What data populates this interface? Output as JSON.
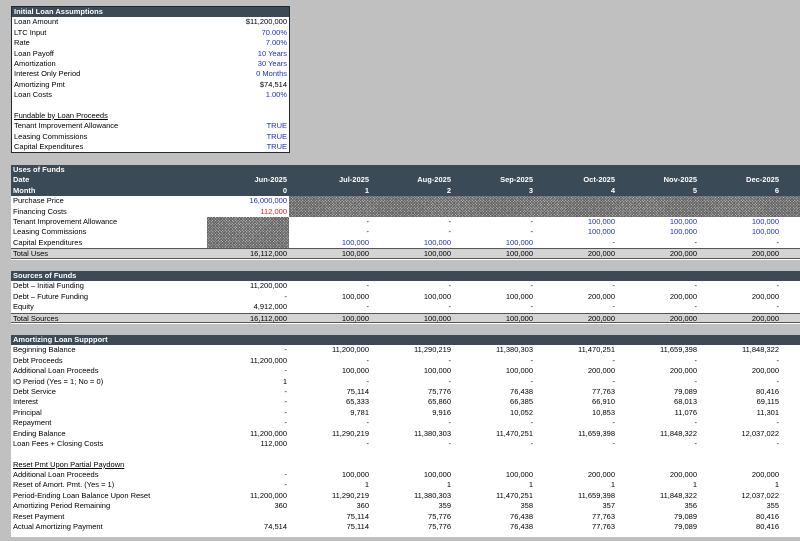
{
  "assumptions": {
    "title": "Initial Loan Assumptions",
    "rows": [
      {
        "label": "Loan Amount",
        "value": "$11,200,000",
        "color": "black"
      },
      {
        "label": "LTC Input",
        "value": "70.00%",
        "color": "blue"
      },
      {
        "label": "Rate",
        "value": "7.00%",
        "color": "blue"
      },
      {
        "label": "Loan Payoff",
        "value": "10 Years",
        "color": "blue"
      },
      {
        "label": "Amortization",
        "value": "30 Years",
        "color": "blue"
      },
      {
        "label": "Interest Only Period",
        "value": "0 Months",
        "color": "blue"
      },
      {
        "label": "Amortizing Pmt",
        "value": "$74,514",
        "color": "black"
      },
      {
        "label": "Loan Costs",
        "value": "1.00%",
        "color": "blue"
      }
    ],
    "fundable_title": "Fundable by Loan Proceeds",
    "fundable_rows": [
      {
        "label": "Tenant Improvement Allowance",
        "value": "TRUE"
      },
      {
        "label": "Leasing Commissions",
        "value": "TRUE"
      },
      {
        "label": "Capital Expenditures",
        "value": "TRUE"
      }
    ]
  },
  "uses": {
    "title": "Uses of Funds",
    "date_label": "Date",
    "month_label": "Month",
    "dates": [
      "Jun-2025",
      "Jul-2025",
      "Aug-2025",
      "Sep-2025",
      "Oct-2025",
      "Nov-2025",
      "Dec-2025"
    ],
    "months": [
      "0",
      "1",
      "2",
      "3",
      "4",
      "5",
      "6"
    ],
    "rows": [
      {
        "label": "Purchase Price",
        "values": [
          "16,000,000",
          "",
          "",
          "",
          "",
          "",
          ""
        ],
        "colors": [
          "blue",
          "",
          "",
          "",
          "",
          "",
          ""
        ]
      },
      {
        "label": "Financing Costs",
        "values": [
          "112,000",
          "",
          "",
          "",
          "",
          "",
          ""
        ],
        "colors": [
          "red",
          "",
          "",
          "",
          "",
          "",
          ""
        ]
      },
      {
        "label": "Tenant Improvement Allowance",
        "values": [
          "",
          "-",
          "-",
          "-",
          "100,000",
          "100,000",
          "100,000"
        ],
        "colors": [
          "",
          "",
          "",
          "",
          "blue",
          "blue",
          "blue"
        ]
      },
      {
        "label": "Leasing Commissions",
        "values": [
          "",
          "-",
          "-",
          "-",
          "100,000",
          "100,000",
          "100,000"
        ],
        "colors": [
          "",
          "",
          "",
          "",
          "blue",
          "blue",
          "blue"
        ]
      },
      {
        "label": "Capital Expenditures",
        "values": [
          "",
          "100,000",
          "100,000",
          "100,000",
          "-",
          "-",
          "-"
        ],
        "colors": [
          "",
          "blue",
          "blue",
          "blue",
          "",
          "",
          ""
        ]
      }
    ],
    "total": {
      "label": "Total Uses",
      "values": [
        "16,112,000",
        "100,000",
        "100,000",
        "100,000",
        "200,000",
        "200,000",
        "200,000"
      ]
    }
  },
  "sources": {
    "title": "Sources of Funds",
    "rows": [
      {
        "label": "Debt – Initial Funding",
        "values": [
          "11,200,000",
          "-",
          "-",
          "-",
          "-",
          "-",
          "-"
        ]
      },
      {
        "label": "Debt – Future Funding",
        "values": [
          "-",
          "100,000",
          "100,000",
          "100,000",
          "200,000",
          "200,000",
          "200,000"
        ]
      },
      {
        "label": "Equity",
        "values": [
          "4,912,000",
          "-",
          "-",
          "-",
          "-",
          "-",
          "-"
        ]
      }
    ],
    "total": {
      "label": "Total Sources",
      "values": [
        "16,112,000",
        "100,000",
        "100,000",
        "100,000",
        "200,000",
        "200,000",
        "200,000"
      ]
    }
  },
  "amort": {
    "title": "Amortizing Loan Suppport",
    "rows": [
      {
        "label": "Beginning Balance",
        "values": [
          "-",
          "11,200,000",
          "11,290,219",
          "11,380,303",
          "11,470,251",
          "11,659,398",
          "11,848,322"
        ]
      },
      {
        "label": "Debt Proceeds",
        "values": [
          "11,200,000",
          "-",
          "-",
          "-",
          "-",
          "-",
          "-"
        ]
      },
      {
        "label": "Additional Loan Proceeds",
        "values": [
          "-",
          "100,000",
          "100,000",
          "100,000",
          "200,000",
          "200,000",
          "200,000"
        ]
      },
      {
        "label": "IO Period (Yes = 1; No = 0)",
        "values": [
          "1",
          "-",
          "-",
          "-",
          "-",
          "-",
          "-"
        ]
      },
      {
        "label": "Debt Service",
        "values": [
          "-",
          "75,114",
          "75,776",
          "76,438",
          "77,763",
          "79,089",
          "80,416"
        ]
      },
      {
        "label": "Interest",
        "values": [
          "-",
          "65,333",
          "65,860",
          "66,385",
          "66,910",
          "68,013",
          "69,115"
        ]
      },
      {
        "label": "Principal",
        "values": [
          "-",
          "9,781",
          "9,916",
          "10,052",
          "10,853",
          "11,076",
          "11,301"
        ]
      },
      {
        "label": "Repayment",
        "values": [
          "-",
          "-",
          "-",
          "-",
          "-",
          "-",
          "-"
        ]
      },
      {
        "label": "Ending Balance",
        "values": [
          "11,200,000",
          "11,290,219",
          "11,380,303",
          "11,470,251",
          "11,659,398",
          "11,848,322",
          "12,037,022"
        ]
      },
      {
        "label": "Loan Fees + Closing Costs",
        "values": [
          "112,000",
          "-",
          "-",
          "-",
          "-",
          "-",
          "-"
        ]
      }
    ],
    "reset_title": "Reset Pmt Upon Partial Paydown",
    "reset_rows": [
      {
        "label": "Additional Loan Proceeds",
        "values": [
          "-",
          "100,000",
          "100,000",
          "100,000",
          "200,000",
          "200,000",
          "200,000"
        ]
      },
      {
        "label": "Reset of Amort. Pmt. (Yes = 1)",
        "values": [
          "-",
          "1",
          "1",
          "1",
          "1",
          "1",
          "1"
        ]
      },
      {
        "label": "Period-Ending Loan Balance Upon Reset",
        "values": [
          "11,200,000",
          "11,290,219",
          "11,380,303",
          "11,470,251",
          "11,659,398",
          "11,848,322",
          "12,037,022"
        ]
      },
      {
        "label": "Amortizing Period Remaining",
        "values": [
          "360",
          "360",
          "359",
          "358",
          "357",
          "356",
          "355"
        ]
      },
      {
        "label": "Reset Payment",
        "values": [
          "",
          "75,114",
          "75,776",
          "76,438",
          "77,763",
          "79,089",
          "80,416"
        ]
      },
      {
        "label": "Actual Amortizing Payment",
        "values": [
          "74,514",
          "75,114",
          "75,776",
          "76,438",
          "77,763",
          "79,089",
          "80,416"
        ]
      }
    ]
  }
}
